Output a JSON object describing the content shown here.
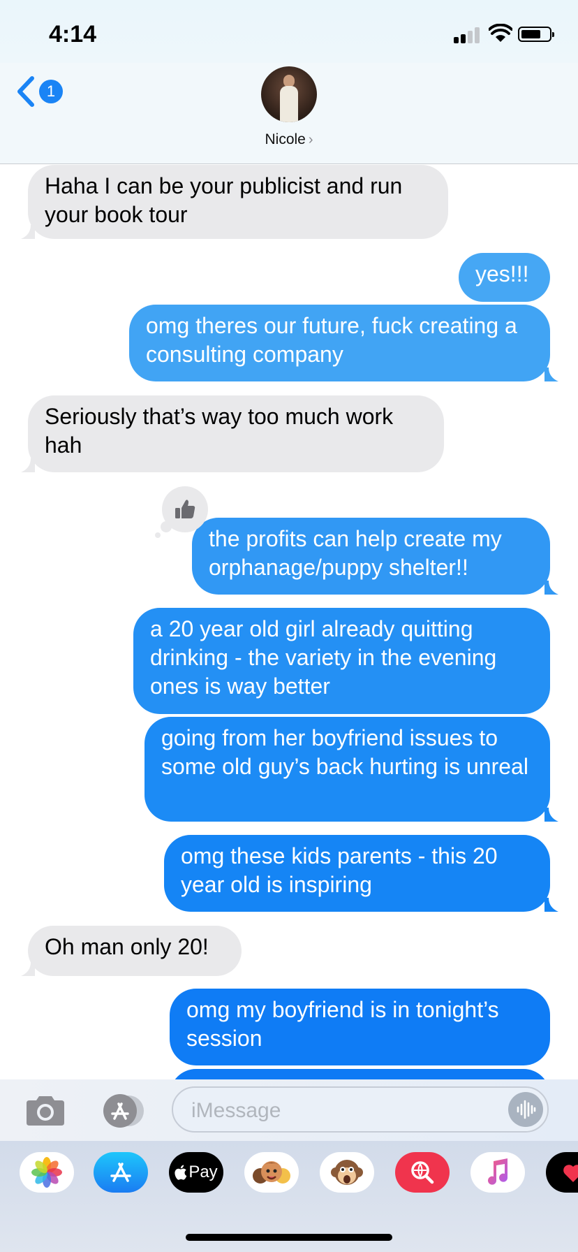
{
  "status_bar": {
    "time": "4:14"
  },
  "header": {
    "back_badge": "1",
    "contact_name": "Nicole"
  },
  "messages": [
    {
      "side": "in",
      "text": "Haha I can be your publicist and run your book tour"
    },
    {
      "side": "out",
      "text": "yes!!!"
    },
    {
      "side": "out",
      "text": "omg theres our future, fuck creating a consulting company"
    },
    {
      "side": "in",
      "text": "Seriously that’s way too much work hah"
    },
    {
      "side": "out",
      "text": "the profits can help create my orphanage/puppy shelter!!",
      "tapback": "thumbs-up"
    },
    {
      "side": "out",
      "text": "a 20 year old girl already quitting drinking - the variety in the evening ones is way better"
    },
    {
      "side": "out",
      "text": "going from her boyfriend issues to some old guy’s back hurting is unreal"
    },
    {
      "side": "out",
      "text": "omg these kids parents - this 20 year old is inspiring"
    },
    {
      "side": "in",
      "text": "Oh man only 20!"
    },
    {
      "side": "out",
      "text": "omg my boyfriend is in tonight’s session"
    }
  ],
  "input": {
    "placeholder": "iMessage"
  },
  "app_drawer": {
    "apps": [
      {
        "name": "photos-app",
        "label": ""
      },
      {
        "name": "app-store-app",
        "label": ""
      },
      {
        "name": "apple-pay-app",
        "label": "Pay"
      },
      {
        "name": "memoji-app",
        "label": ""
      },
      {
        "name": "animoji-app",
        "label": ""
      },
      {
        "name": "web-images-app",
        "label": ""
      },
      {
        "name": "music-app",
        "label": ""
      },
      {
        "name": "digital-touch-app",
        "label": ""
      }
    ]
  },
  "colors": {
    "incoming_bubble": "#e9e9eb",
    "outgoing_top": "#45a7f4",
    "outgoing_bottom": "#0f7cf5",
    "accent": "#1a84f5"
  }
}
